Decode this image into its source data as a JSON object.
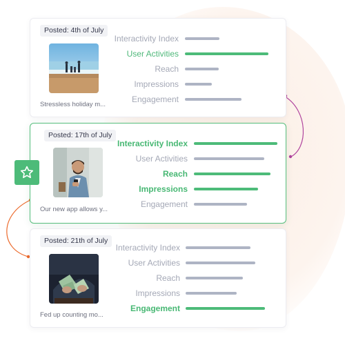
{
  "posts": [
    {
      "posted": "Posted: 4th of July",
      "caption": "Stressless holiday m...",
      "image": "family-on-beach-photo",
      "metrics": [
        {
          "label": "Interactivity Index",
          "value": 0.4,
          "highlight": false
        },
        {
          "label": "User Activities",
          "value": 0.96,
          "highlight": true
        },
        {
          "label": "Reach",
          "value": 0.39,
          "highlight": false
        },
        {
          "label": "Impressions",
          "value": 0.31,
          "highlight": false
        },
        {
          "label": "Engagement",
          "value": 0.65,
          "highlight": false
        }
      ]
    },
    {
      "posted": "Posted: 17th of July",
      "caption": "Our new app allows y...",
      "image": "man-using-phone-photo",
      "metrics": [
        {
          "label": "Interactivity Index",
          "value": 1.0,
          "highlight": true
        },
        {
          "label": "User Activities",
          "value": 0.84,
          "highlight": false
        },
        {
          "label": "Reach",
          "value": 0.92,
          "highlight": true
        },
        {
          "label": "Impressions",
          "value": 0.77,
          "highlight": true
        },
        {
          "label": "Engagement",
          "value": 0.64,
          "highlight": false
        }
      ]
    },
    {
      "posted": "Posted: 21th of July",
      "caption": "Fed up counting mo...",
      "image": "hands-counting-money-photo",
      "metrics": [
        {
          "label": "Interactivity Index",
          "value": 0.78,
          "highlight": false
        },
        {
          "label": "User Activities",
          "value": 0.84,
          "highlight": false
        },
        {
          "label": "Reach",
          "value": 0.69,
          "highlight": false
        },
        {
          "label": "Impressions",
          "value": 0.62,
          "highlight": false
        },
        {
          "label": "Engagement",
          "value": 0.96,
          "highlight": true
        }
      ]
    }
  ],
  "active_post_index": 1,
  "colors": {
    "accent": "#4dbb79",
    "bar_default": "#aeb4c4",
    "label_default": "#a4a8b6",
    "connector_top": "#b0449e",
    "connector_bottom": "#ec6a2c"
  },
  "icons": {
    "favorite_badge": "star-icon"
  }
}
